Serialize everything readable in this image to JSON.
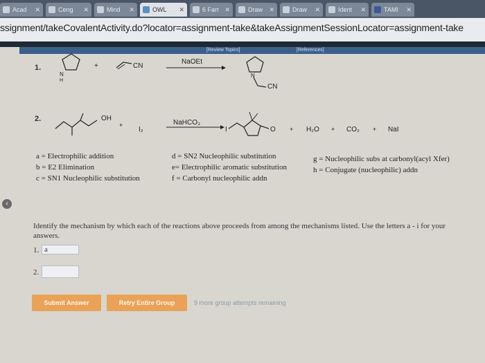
{
  "browser": {
    "tabs": [
      {
        "label": "Acad",
        "active": false
      },
      {
        "label": "Ceng",
        "active": false
      },
      {
        "label": "Mind",
        "active": false
      },
      {
        "label": "OWL",
        "active": true
      },
      {
        "label": "6 Farr",
        "active": false
      },
      {
        "label": "Draw",
        "active": false
      },
      {
        "label": "Draw",
        "active": false
      },
      {
        "label": "Ident",
        "active": false
      },
      {
        "label": "TAMI",
        "active": false
      }
    ],
    "url": "ssignment/takeCovalentActivity.do?locator=assignment-take&takeAssignmentSessionLocator=assignment-take"
  },
  "header": {
    "review_topics": "[Review Topics]",
    "references": "[References]"
  },
  "reactions": [
    {
      "number": "1.",
      "plus": "+",
      "reagent2": "CN",
      "conditions": "NaOEt",
      "product_label": "CN"
    },
    {
      "number": "2.",
      "oh": "OH",
      "plus": "+",
      "i2": "I₂",
      "conditions": "NaHCO₃",
      "i_label": "I",
      "o_label": "O",
      "byproducts": [
        "H₂O",
        "CO₂",
        "NaI"
      ]
    }
  ],
  "mechanisms": {
    "a": "a = Electrophilic addition",
    "b": "b = E2 Elimination",
    "c": "c = SN1 Nucleophilic substitution",
    "d": "d = SN2 Nucleophilic substitution",
    "e": "e= Electrophilic aromatic substitution",
    "f": "f = Carbonyl nucleophilic addn",
    "g": "g = Nucleophilic subs at carbonyl(acyl Xfer)",
    "h": "h = Conjugate (nucleophilic) addn"
  },
  "instructions": "Identify the mechanism by which each of the reactions above proceeds from among the mechanisms listed. Use the letters a - i for your answers.",
  "answers": [
    {
      "label": "1.",
      "value": "a"
    },
    {
      "label": "2.",
      "value": ""
    }
  ],
  "buttons": {
    "submit": "Submit Answer",
    "retry": "Retry Entire Group"
  },
  "remaining": "9 more group attempts remaining"
}
